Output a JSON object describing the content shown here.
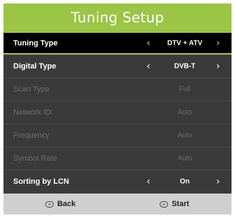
{
  "header": {
    "title": "Tuning Setup"
  },
  "menu": {
    "rows": [
      {
        "label": "Tuning Type",
        "value": "DTV + ATV",
        "state": "selected"
      },
      {
        "label": "Digital Type",
        "value": "DVB-T",
        "state": "enabled"
      },
      {
        "label": "Scan Type",
        "value": "Full",
        "state": "disabled"
      },
      {
        "label": "Network ID",
        "value": "Auto",
        "state": "disabled"
      },
      {
        "label": "Frequency",
        "value": "Auto",
        "state": "disabled"
      },
      {
        "label": "Symbol Rate",
        "value": "Auto",
        "state": "disabled"
      },
      {
        "label": "Sorting by LCN",
        "value": "On",
        "state": "enabled"
      }
    ],
    "left_arrow_glyph": "‹",
    "right_arrow_glyph": "›"
  },
  "footer": {
    "back_label": "Back",
    "start_label": "Start",
    "back_icon": "menu-button-icon",
    "start_icon": "ok-button-icon"
  },
  "colors": {
    "accent": "#9bc546",
    "background": "#3a3a3a",
    "footer": "#cfcfcf"
  }
}
